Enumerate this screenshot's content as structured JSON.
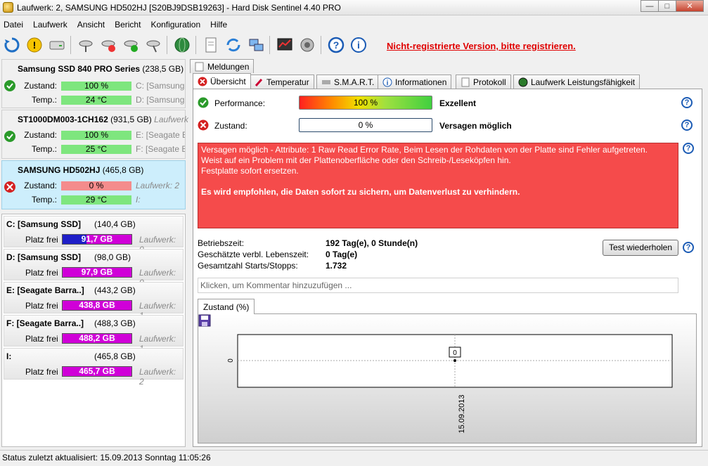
{
  "window": {
    "title": "Laufwerk: 2, SAMSUNG HD502HJ [S20BJ9DSB19263]  -  Hard Disk Sentinel 4.40 PRO",
    "min": "—",
    "max": "□",
    "close": "✕"
  },
  "menu": [
    "Datei",
    "Laufwerk",
    "Ansicht",
    "Bericht",
    "Konfiguration",
    "Hilfe"
  ],
  "toolbar": {
    "unregistered": "Nicht-registrierte Version, bitte registrieren."
  },
  "disks": [
    {
      "name": "Samsung SSD 840 PRO Series",
      "size": "(238,5 GB)",
      "zustand_label": "Zustand:",
      "zustand": "100 %",
      "temp_label": "Temp.:",
      "temp": "24 °C",
      "side1": "C: [Samsung S",
      "side2": "D: [Samsung"
    },
    {
      "name": "ST1000DM003-1CH162",
      "size": "(931,5 GB)",
      "side0": "Laufwerk",
      "zustand_label": "Zustand:",
      "zustand": "100 %",
      "temp_label": "Temp.:",
      "temp": "25 °C",
      "side1": "E: [Seagate Ba",
      "side2": "F: [Seagate Ba"
    },
    {
      "name": "SAMSUNG HD502HJ",
      "size": "(465,8 GB)",
      "zustand_label": "Zustand:",
      "zustand": "0 %",
      "temp_label": "Temp.:",
      "temp": "29 °C",
      "side1": "Laufwerk: 2",
      "side2": "I:"
    }
  ],
  "volumes": [
    {
      "name": "C: [Samsung SSD]",
      "size": "(140,4 GB)",
      "free_label": "Platz frei",
      "free": "91,7 GB",
      "drive": "Laufwerk: 0",
      "used_frac": 0.35
    },
    {
      "name": "D: [Samsung SSD]",
      "size": "(98,0 GB)",
      "free_label": "Platz frei",
      "free": "97,9 GB",
      "drive": "Laufwerk: 0",
      "used_frac": 0.0
    },
    {
      "name": "E: [Seagate Barra..]",
      "size": "(443,2 GB)",
      "free_label": "Platz frei",
      "free": "438,8 GB",
      "drive": "Laufwerk: 1",
      "used_frac": 0.0
    },
    {
      "name": "F: [Seagate Barra..]",
      "size": "(488,3 GB)",
      "free_label": "Platz frei",
      "free": "488,2 GB",
      "drive": "Laufwerk: 1",
      "used_frac": 0.0
    },
    {
      "name": "I:",
      "size": "(465,8 GB)",
      "free_label": "Platz frei",
      "free": "465,7 GB",
      "drive": "Laufwerk: 2",
      "used_frac": 0.0
    }
  ],
  "tabs": {
    "meldungen": "Meldungen",
    "uebersicht": "Übersicht",
    "temperatur": "Temperatur",
    "smart": "S.M.A.R.T.",
    "informationen": "Informationen",
    "protokoll": "Protokoll",
    "leistung": "Laufwerk Leistungsfähigkeit"
  },
  "overview": {
    "performance_label": "Performance:",
    "performance_value": "100 %",
    "performance_verdict": "Exzellent",
    "zustand_label": "Zustand:",
    "zustand_value": "0 %",
    "zustand_verdict": "Versagen möglich",
    "alert": {
      "line1": "Versagen möglich - Attribute: 1 Raw Read Error Rate, Beim Lesen der Rohdaten von der Platte sind Fehler aufgetreten.",
      "line2": "Weist auf ein Problem mit der Plattenoberfläche oder den Schreib-/Leseköpfen hin.",
      "line3": "Festplatte sofort ersetzen.",
      "line4": "Es wird empfohlen, die Daten sofort zu sichern, um Datenverlust zu verhindern."
    },
    "betriebszeit_label": "Betriebszeit:",
    "betriebszeit": "192 Tag(e), 0 Stunde(n)",
    "lebenszeit_label": "Geschätzte verbl. Lebenszeit:",
    "lebenszeit": "0 Tag(e)",
    "starts_label": "Gesamtzahl Starts/Stopps:",
    "starts": "1.732",
    "test_button": "Test wiederholen",
    "comment_placeholder": "Klicken, um Kommentar hinzuzufügen ...",
    "chart_tab": "Zustand (%)"
  },
  "chart_data": {
    "type": "line",
    "x": [
      "15.09.2013"
    ],
    "values": [
      0
    ],
    "yticks": [
      "0"
    ],
    "point_label": "0"
  },
  "status": {
    "text": "Status zuletzt aktualisiert: 15.09.2013 Sonntag 11:05:26"
  },
  "colors": {
    "ok": "#2a9a2a",
    "fail": "#d42020",
    "alert_bg": "#f54b4b",
    "link": "#e00000"
  }
}
